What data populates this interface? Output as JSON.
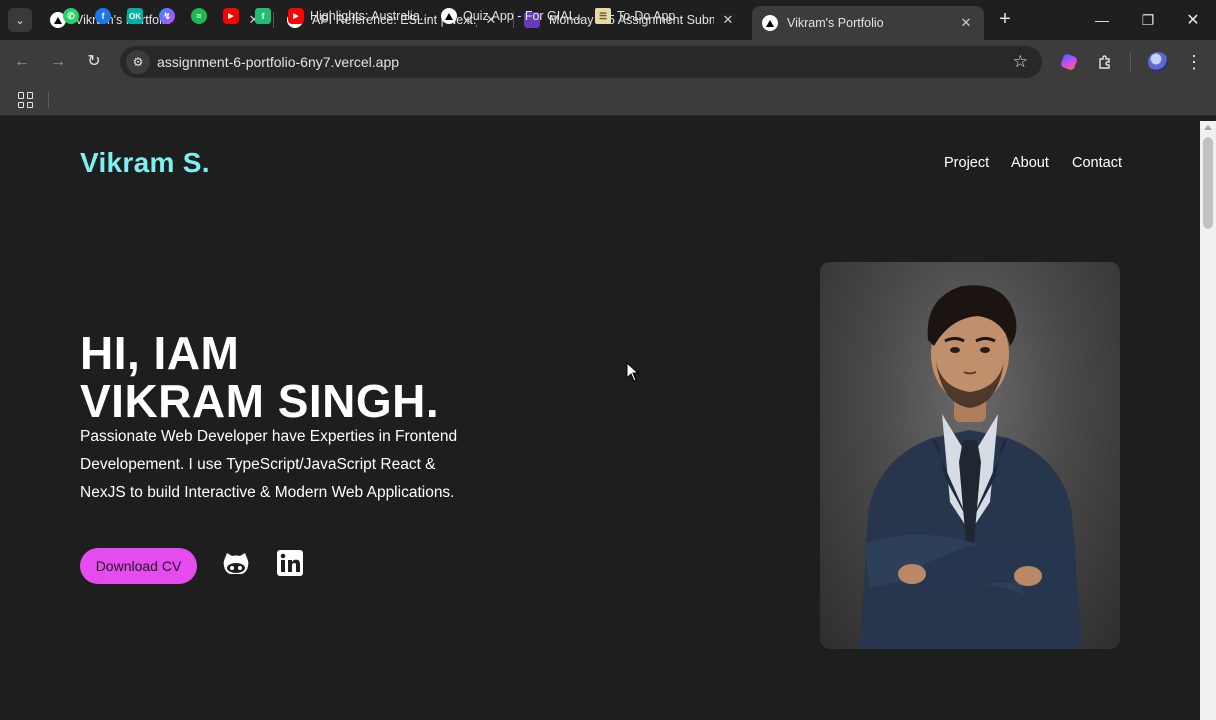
{
  "browser": {
    "tabs": [
      {
        "title": "Vikram's Portfolio",
        "active": false
      },
      {
        "title": "API Reference: ESLint | Next.js",
        "active": false
      },
      {
        "title": "Monday 2-5 Assignment Submi",
        "active": false
      },
      {
        "title": "Vikram's Portfolio",
        "active": true
      }
    ],
    "url": "assignment-6-portfolio-6ny7.vercel.app",
    "bookmarks": [
      {
        "label": "",
        "icon": "whatsapp-icon",
        "color": "#25d366"
      },
      {
        "label": "",
        "icon": "facebook-icon",
        "color": "#1877f2"
      },
      {
        "label": "",
        "icon": "okru-icon",
        "color": "#00b3a0"
      },
      {
        "label": "",
        "icon": "messenger-icon",
        "color": "#a04bff"
      },
      {
        "label": "",
        "icon": "spotify-icon",
        "color": "#1db954"
      },
      {
        "label": "",
        "icon": "youtube-icon",
        "color": "#ff0000"
      },
      {
        "label": "",
        "icon": "fiverr-icon",
        "color": "#1dbf73"
      },
      {
        "label": "Highlights: Australia...",
        "icon": "youtube-icon",
        "color": "#ff0000"
      },
      {
        "label": "Quiz App - For GIAI...",
        "icon": "vercel-icon",
        "color": "#ffffff"
      },
      {
        "label": "To-Do App",
        "icon": "notepad-icon",
        "color": "#e8d9a8"
      }
    ]
  },
  "site": {
    "logo": "Vikram S.",
    "nav": [
      "Project",
      "About",
      "Contact"
    ],
    "hero": {
      "title_line1": "HI, IAM",
      "title_line2": "VIKRAM SINGH.",
      "description": "Passionate Web Developer have Experties in Frontend Developement. I use TypeScript/JavaScript React & NexJS to build Interactive & Modern Web Applications.",
      "cta_label": "Download CV"
    },
    "colors": {
      "accent": "#7ef0ef",
      "button": "#e64bf0",
      "background": "#1e1e1e"
    }
  }
}
